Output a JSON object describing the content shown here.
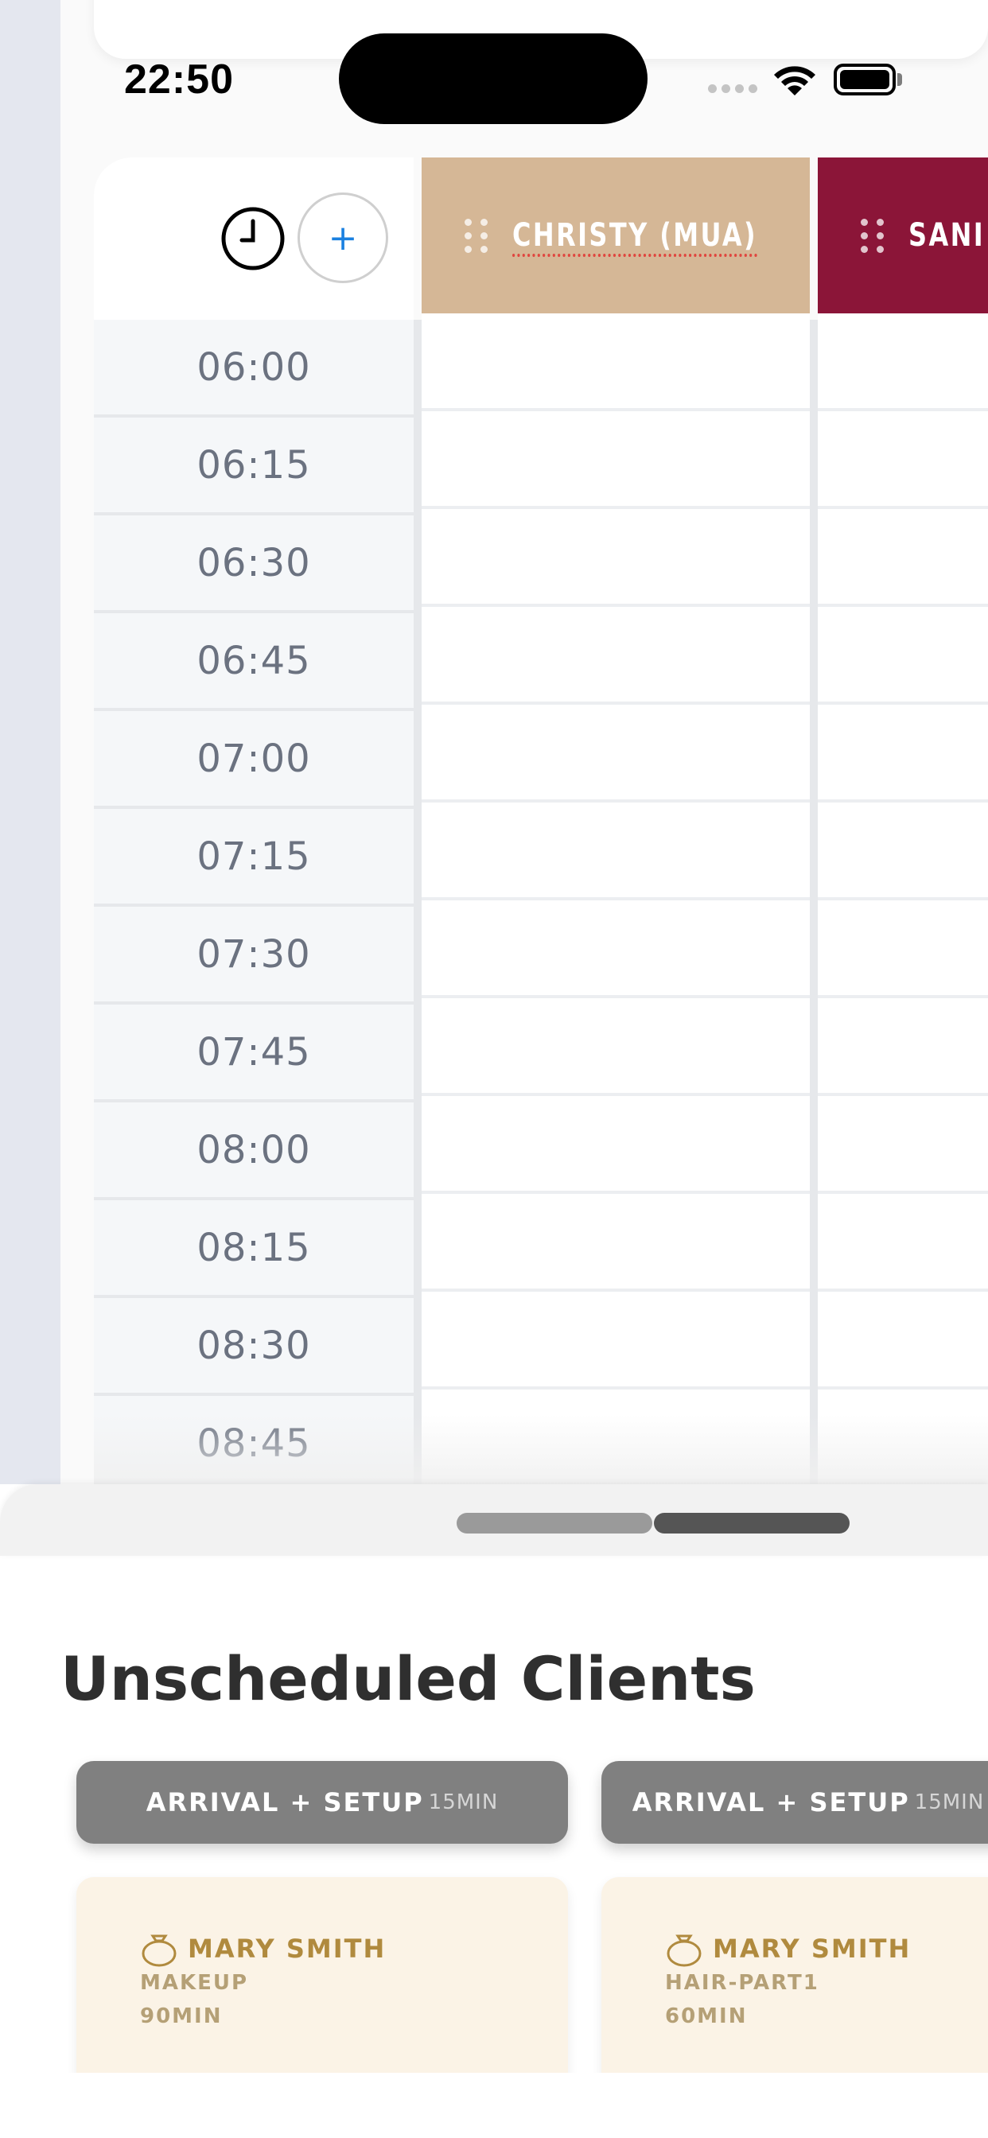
{
  "status_bar": {
    "time": "22:50"
  },
  "schedule": {
    "add_label": "+",
    "staff": [
      {
        "name": "CHRISTY (MUA)",
        "color": "#d5b796"
      },
      {
        "name": "SANI",
        "color": "#8b1538"
      }
    ],
    "times": [
      "06:00",
      "06:15",
      "06:30",
      "06:45",
      "07:00",
      "07:15",
      "07:30",
      "07:45",
      "08:00",
      "08:15",
      "08:30",
      "08:45"
    ]
  },
  "unscheduled": {
    "title": "Unscheduled Clients",
    "setup_pills": [
      {
        "label": "ARRIVAL + SETUP",
        "duration": "15MIN"
      },
      {
        "label": "ARRIVAL + SETUP",
        "duration": "15MIN"
      }
    ],
    "clients": [
      {
        "name": "MARY SMITH",
        "service": "MAKEUP",
        "duration": "90MIN",
        "icon": "ring-icon"
      },
      {
        "name": "MARY SMITH",
        "service": "HAIR-PART1",
        "duration": "60MIN",
        "icon": "ring-icon"
      }
    ]
  },
  "colors": {
    "accent_gold": "#b08a3e",
    "add_button_blue": "#1a80e0"
  }
}
